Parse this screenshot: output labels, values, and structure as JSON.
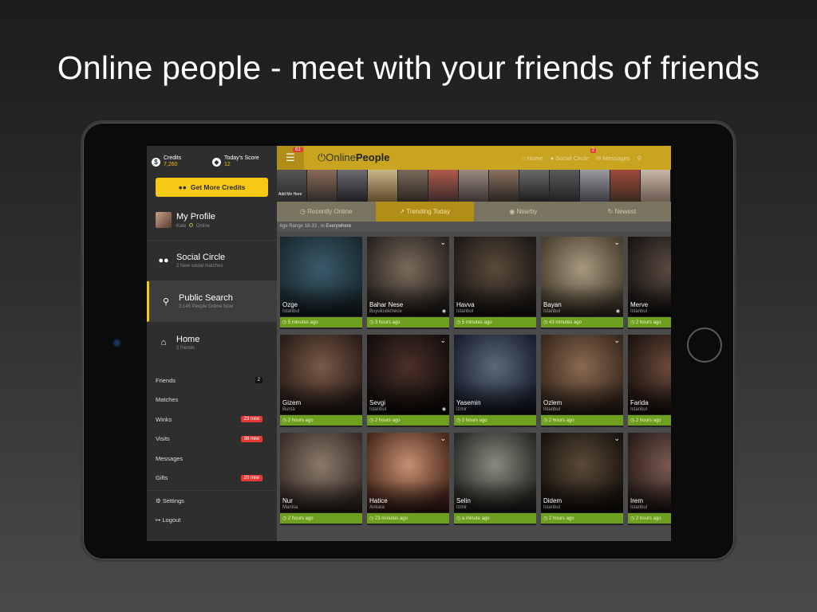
{
  "headline": "Online people - meet with your friends of friends",
  "sidebar": {
    "credits_label": "Credits",
    "credits_value": "7,260",
    "score_label": "Today's Score",
    "score_value": "12",
    "get_credits": "Get More Credits",
    "profile": {
      "title": "My Profile",
      "name": "Kate",
      "status": "Online"
    },
    "social": {
      "title": "Social Circle",
      "sub": "2 New social matches"
    },
    "search": {
      "title": "Public Search",
      "sub": "3,145 People Online Now"
    },
    "home": {
      "title": "Home",
      "sub": "2 friends"
    },
    "items": [
      {
        "label": "Friends",
        "badge": "2"
      },
      {
        "label": "Matches",
        "badge": ""
      },
      {
        "label": "Winks",
        "badge": "23 new"
      },
      {
        "label": "Visits",
        "badge": "38 new"
      },
      {
        "label": "Messages",
        "badge": ""
      },
      {
        "label": "Gifts",
        "badge": "20 new"
      }
    ],
    "settings": "Settings",
    "logout": "Logout"
  },
  "topbar": {
    "menu_count": "61",
    "logo_prefix": "Online",
    "logo_bold": "People",
    "nav": {
      "home": "Home",
      "social": "Social Circle",
      "social_badge": "2",
      "messages": "Messages"
    }
  },
  "strip": {
    "add_me": "Add Me Here"
  },
  "tabs": [
    "Recently Online",
    "Trending Today",
    "Nearby",
    "Newest"
  ],
  "filter": {
    "prefix": "Age Range 18-33 , in",
    "location": "Everywhere"
  },
  "cards": [
    {
      "name": "Ozge",
      "city": "Istanbul",
      "time": "5 minutes ago"
    },
    {
      "name": "Bahar Nese",
      "city": "Buyukcekmece",
      "time": "3 hours ago"
    },
    {
      "name": "Havva",
      "city": "Istanbul",
      "time": "5 minutes ago"
    },
    {
      "name": "Bayan",
      "city": "Istanbul",
      "time": "43 minutes ago"
    },
    {
      "name": "Merve",
      "city": "Istanbul",
      "time": "2 hours ago"
    },
    {
      "name": "Gizem",
      "city": "Bursa",
      "time": "2 hours ago"
    },
    {
      "name": "Sevgi",
      "city": "Istanbul",
      "time": "2 hours ago"
    },
    {
      "name": "Yasemin",
      "city": "Izmir",
      "time": "2 hours ago"
    },
    {
      "name": "Ozlem",
      "city": "Istanbul",
      "time": "2 hours ago"
    },
    {
      "name": "Farida",
      "city": "Istanbul",
      "time": "2 hours ago"
    },
    {
      "name": "Nur",
      "city": "Manisa",
      "time": "2 hours ago"
    },
    {
      "name": "Hatice",
      "city": "Ankara",
      "time": "23 minutes ago"
    },
    {
      "name": "Selin",
      "city": "Izmir",
      "time": "a minute ago"
    },
    {
      "name": "Didem",
      "city": "Istanbul",
      "time": "2 hours ago"
    },
    {
      "name": "Irem",
      "city": "Istanbul",
      "time": "2 hours ago"
    }
  ]
}
